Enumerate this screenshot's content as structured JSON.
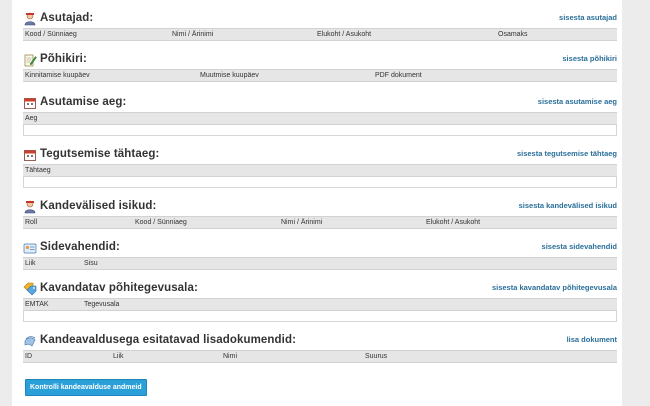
{
  "sections": {
    "asutajad": {
      "title": "Asutajad:",
      "link": "sisesta asutajad",
      "icon": "person-icon",
      "columns": [
        "Kood / Sünniaeg",
        "Nimi / Ärinimi",
        "Elukoht / Asukoht",
        "Osamaks"
      ]
    },
    "pohikiri": {
      "title": "Põhikiri:",
      "link": "sisesta põhikiri",
      "icon": "document-edit-icon",
      "columns": [
        "Kinnitamise kuupäev",
        "Muutmise kuupäev",
        "PDF dokument"
      ]
    },
    "asutamise_aeg": {
      "title": "Asutamise aeg:",
      "link": "sisesta asutamise aeg",
      "icon": "calendar-icon",
      "columns": [
        "Aeg"
      ]
    },
    "tegutsemise_tahtaeg": {
      "title": "Tegutsemise tähtaeg:",
      "link": "sisesta tegutsemise tähtaeg",
      "icon": "calendar-icon",
      "columns": [
        "Tähtaeg"
      ]
    },
    "kandevalised_isikud": {
      "title": "Kandevälised isikud:",
      "link": "sisesta kandevälised isikud",
      "icon": "person-icon",
      "columns": [
        "Roll",
        "Kood / Sünniaeg",
        "Nimi / Ärinimi",
        "Elukoht / Asukoht"
      ]
    },
    "sidevahendid": {
      "title": "Sidevahendid:",
      "link": "sisesta sidevahendid",
      "icon": "contact-card-icon",
      "columns": [
        "Liik",
        "Sisu"
      ]
    },
    "pohitegevusala": {
      "title": "Kavandatav põhitegevusala:",
      "link": "sisesta kavandatav põhitegevusala",
      "icon": "tags-icon",
      "columns": [
        "EMTAK",
        "Tegevusala"
      ]
    },
    "lisadokumendid": {
      "title": "Kandeavaldusega esitatavad lisadokumendid:",
      "link": "lisa dokument",
      "icon": "documents-icon",
      "columns": [
        "ID",
        "Liik",
        "Nimi",
        "Suurus"
      ]
    }
  },
  "actions": {
    "check_button": "Kontrolli kandeavalduse andmeid"
  }
}
